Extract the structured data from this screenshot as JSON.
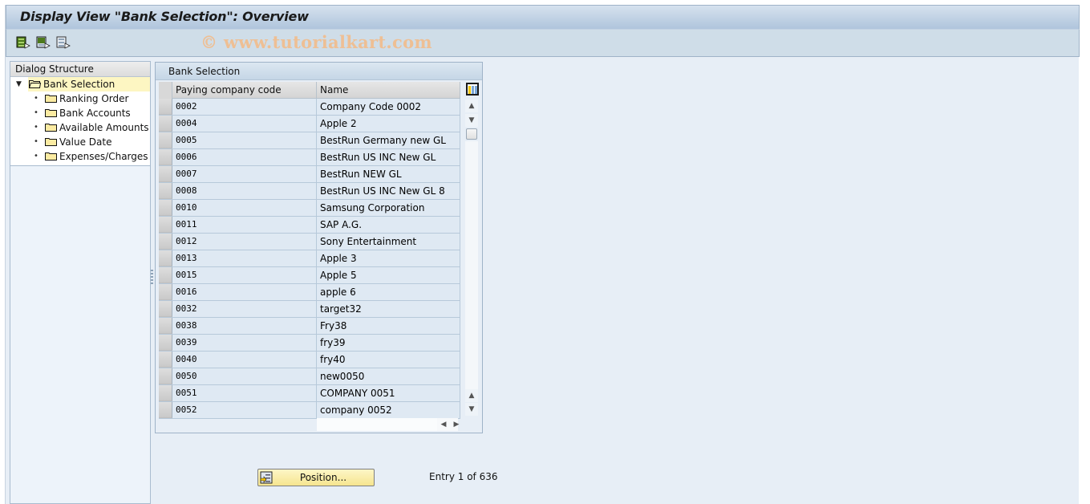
{
  "window": {
    "title": "Display View \"Bank Selection\": Overview"
  },
  "toolbar": {
    "buttons": [
      {
        "icon": "select-all-icon",
        "label": "Select All"
      },
      {
        "icon": "select-block-icon",
        "label": "Select Block"
      },
      {
        "icon": "deselect-all-icon",
        "label": "Deselect All"
      }
    ],
    "watermark": "© www.tutorialkart.com"
  },
  "dialog_structure": {
    "heading": "Dialog Structure",
    "root": {
      "label": "Bank Selection",
      "icon": "folder-open-icon",
      "selected": true,
      "expanded": true
    },
    "children": [
      {
        "label": "Ranking Order",
        "icon": "folder-icon"
      },
      {
        "label": "Bank Accounts",
        "icon": "folder-icon"
      },
      {
        "label": "Available Amounts",
        "icon": "folder-icon"
      },
      {
        "label": "Value Date",
        "icon": "folder-icon"
      },
      {
        "label": "Expenses/Charges",
        "icon": "folder-icon"
      }
    ]
  },
  "table": {
    "title": "Bank Selection",
    "columns": [
      "Paying company code",
      "Name"
    ],
    "rows": [
      {
        "code": "0002",
        "name": "Company Code 0002"
      },
      {
        "code": "0004",
        "name": "Apple 2"
      },
      {
        "code": "0005",
        "name": "BestRun Germany new GL"
      },
      {
        "code": "0006",
        "name": "BestRun US INC New GL"
      },
      {
        "code": "0007",
        "name": "BestRun NEW GL"
      },
      {
        "code": "0008",
        "name": "BestRun US INC New GL 8"
      },
      {
        "code": "0010",
        "name": "Samsung Corporation"
      },
      {
        "code": "0011",
        "name": "SAP A.G."
      },
      {
        "code": "0012",
        "name": "Sony Entertainment"
      },
      {
        "code": "0013",
        "name": "Apple 3"
      },
      {
        "code": "0015",
        "name": "Apple 5"
      },
      {
        "code": "0016",
        "name": "apple 6"
      },
      {
        "code": "0032",
        "name": "target32"
      },
      {
        "code": "0038",
        "name": "Fry38"
      },
      {
        "code": "0039",
        "name": "fry39"
      },
      {
        "code": "0040",
        "name": "fry40"
      },
      {
        "code": "0050",
        "name": "new0050"
      },
      {
        "code": "0051",
        "name": "COMPANY 0051"
      },
      {
        "code": "0052",
        "name": "company 0052"
      }
    ]
  },
  "footer": {
    "position_button": "Position...",
    "entry_info": "Entry 1 of 636"
  }
}
